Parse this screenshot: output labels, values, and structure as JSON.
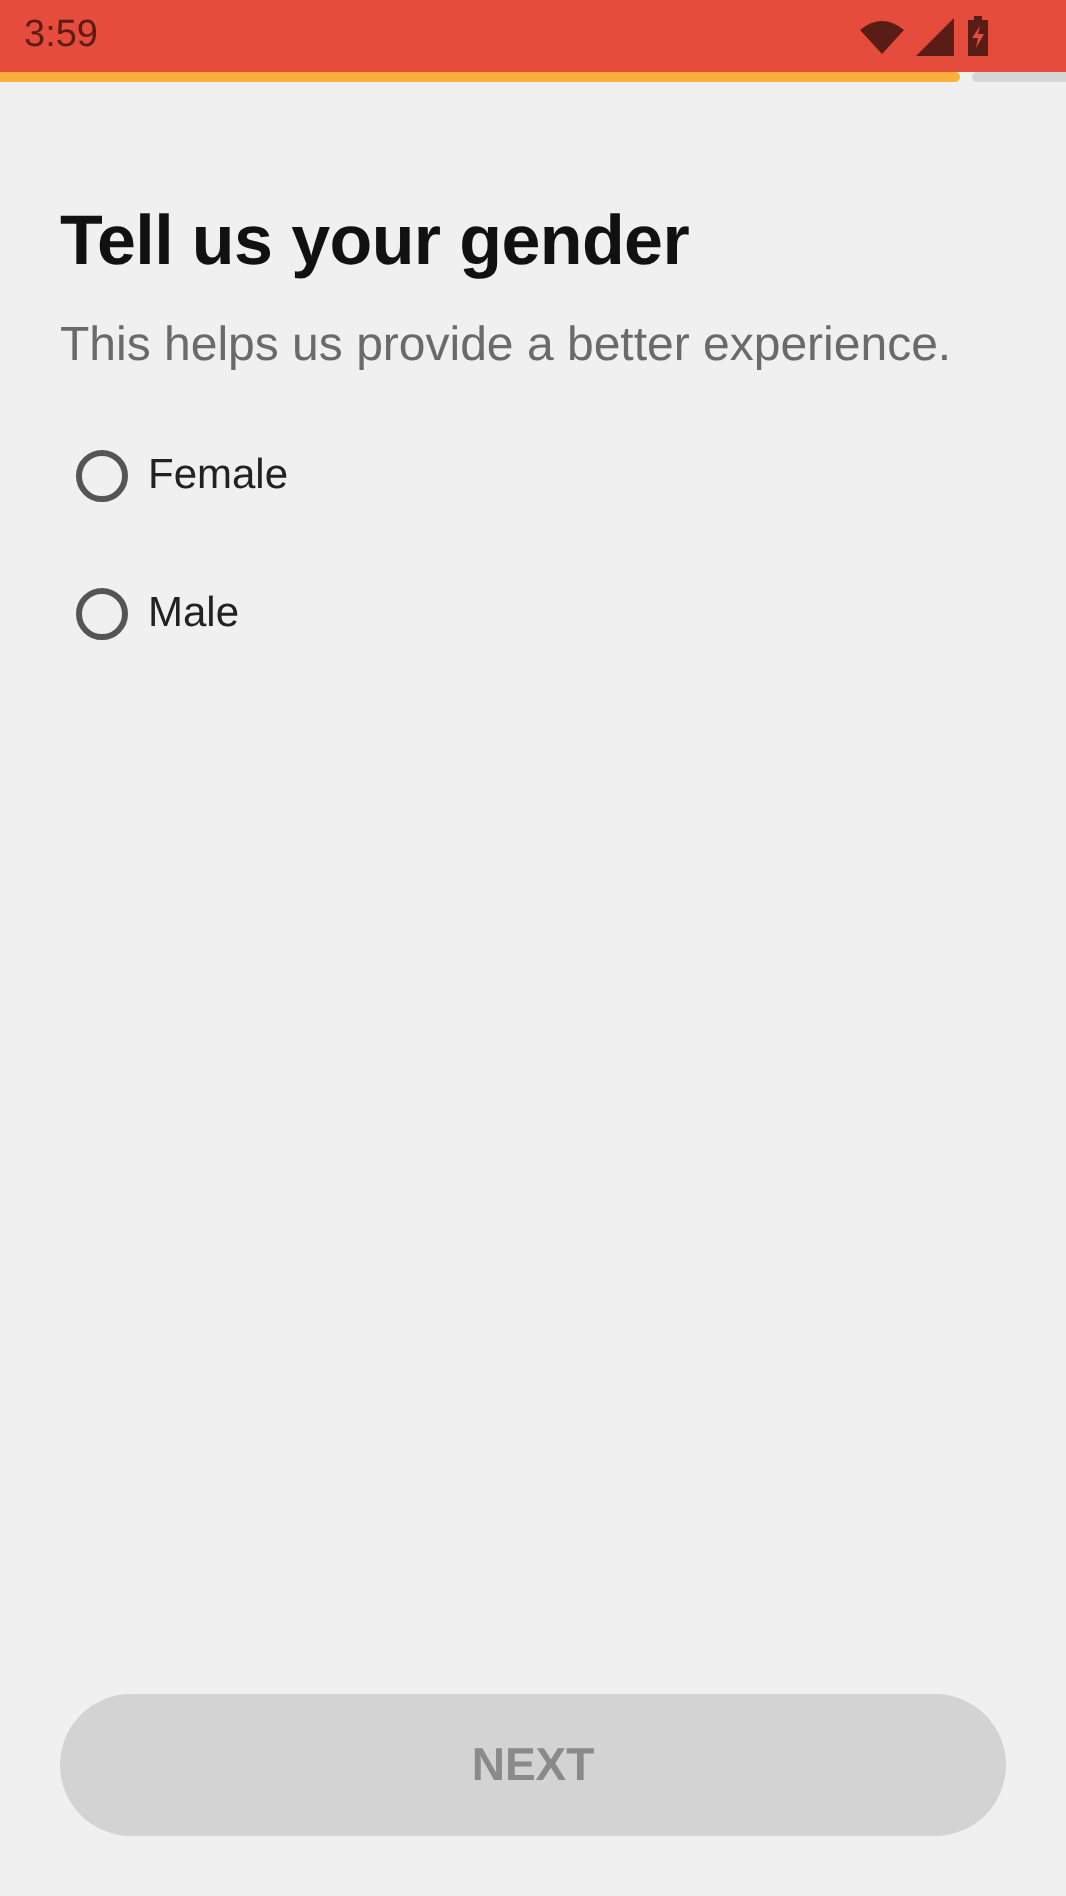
{
  "status_bar": {
    "time": "3:59"
  },
  "progress": {
    "level": 0.91
  },
  "title": "Tell us your gender",
  "subtitle": "This helps us provide a better experience.",
  "options": [
    {
      "label": "Female",
      "selected": false
    },
    {
      "label": "Male",
      "selected": false
    }
  ],
  "next_button": {
    "label": "NEXT",
    "disabled": true
  }
}
